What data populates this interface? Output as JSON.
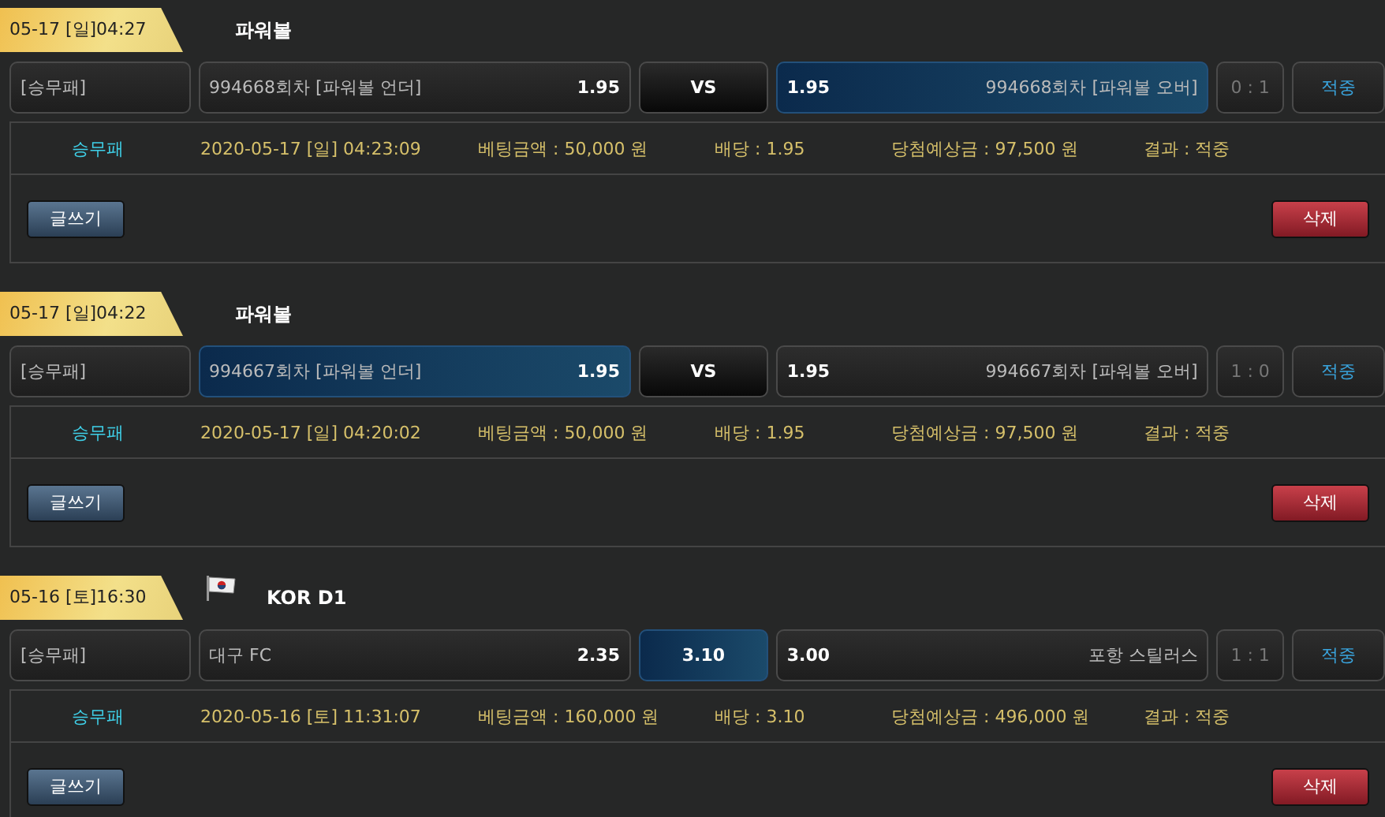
{
  "bets": [
    {
      "date_badge": "05-17 [일]04:27",
      "league": "파워볼",
      "flag": false,
      "market": "[승무패]",
      "home": {
        "name": "994668회차 [파워볼 언더]",
        "odds": "1.95",
        "selected": false
      },
      "draw": {
        "label": "VS",
        "selected": false
      },
      "away": {
        "odds": "1.95",
        "name": "994668회차 [파워볼 오버]",
        "selected": true
      },
      "score": "0 : 1",
      "result": "적중",
      "info": {
        "type": "승무패",
        "time": "2020-05-17 [일] 04:23:09",
        "amount": "베팅금액 : 50,000 원",
        "odds": "배당 : 1.95",
        "expected": "당첨예상금 : 97,500 원",
        "outcome": "결과 : 적중"
      },
      "write_button": "글쓰기",
      "delete_button": "삭제"
    },
    {
      "date_badge": "05-17 [일]04:22",
      "league": "파워볼",
      "flag": false,
      "market": "[승무패]",
      "home": {
        "name": "994667회차 [파워볼 언더]",
        "odds": "1.95",
        "selected": true
      },
      "draw": {
        "label": "VS",
        "selected": false
      },
      "away": {
        "odds": "1.95",
        "name": "994667회차 [파워볼 오버]",
        "selected": false
      },
      "score": "1 : 0",
      "result": "적중",
      "info": {
        "type": "승무패",
        "time": "2020-05-17 [일] 04:20:02",
        "amount": "베팅금액 : 50,000 원",
        "odds": "배당 : 1.95",
        "expected": "당첨예상금 : 97,500 원",
        "outcome": "결과 : 적중"
      },
      "write_button": "글쓰기",
      "delete_button": "삭제"
    },
    {
      "date_badge": "05-16 [토]16:30",
      "league": "KOR D1",
      "flag": true,
      "market": "[승무패]",
      "home": {
        "name": "대구 FC",
        "odds": "2.35",
        "selected": false
      },
      "draw": {
        "label": "3.10",
        "selected": true
      },
      "away": {
        "odds": "3.00",
        "name": "포항 스틸러스",
        "selected": false
      },
      "score": "1 : 1",
      "result": "적중",
      "info": {
        "type": "승무패",
        "time": "2020-05-16 [토] 11:31:07",
        "amount": "베팅금액 : 160,000 원",
        "odds": "배당 : 3.10",
        "expected": "당첨예상금 : 496,000 원",
        "outcome": "결과 : 적중"
      },
      "write_button": "글쓰기",
      "delete_button": "삭제"
    }
  ]
}
